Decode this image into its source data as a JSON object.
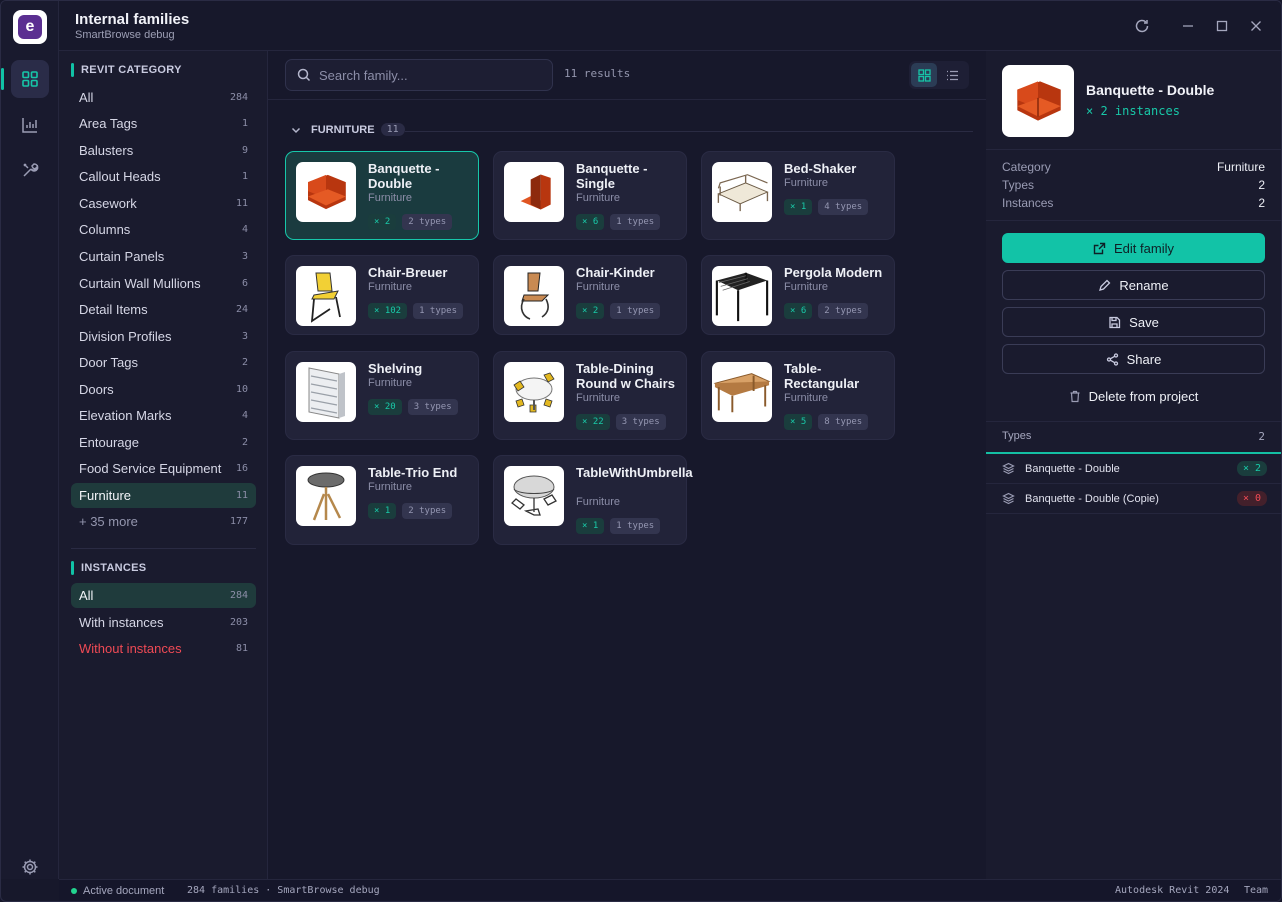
{
  "window": {
    "title": "Internal families",
    "subtitle": "SmartBrowse debug"
  },
  "rail": {
    "items": [
      "grid-icon",
      "chart-icon",
      "tools-icon"
    ],
    "settings": "gear-icon"
  },
  "sidebar": {
    "category_header": "REVIT CATEGORY",
    "categories": [
      {
        "label": "All",
        "count": "284"
      },
      {
        "label": "Area Tags",
        "count": "1"
      },
      {
        "label": "Balusters",
        "count": "9"
      },
      {
        "label": "Callout Heads",
        "count": "1"
      },
      {
        "label": "Casework",
        "count": "11"
      },
      {
        "label": "Columns",
        "count": "4"
      },
      {
        "label": "Curtain Panels",
        "count": "3"
      },
      {
        "label": "Curtain Wall Mullions",
        "count": "6"
      },
      {
        "label": "Detail Items",
        "count": "24"
      },
      {
        "label": "Division Profiles",
        "count": "3"
      },
      {
        "label": "Door Tags",
        "count": "2"
      },
      {
        "label": "Doors",
        "count": "10"
      },
      {
        "label": "Elevation Marks",
        "count": "4"
      },
      {
        "label": "Entourage",
        "count": "2"
      },
      {
        "label": "Food Service Equipment",
        "count": "16"
      },
      {
        "label": "Furniture",
        "count": "11"
      },
      {
        "label": "+ 35 more",
        "count": "177"
      }
    ],
    "instances_header": "INSTANCES",
    "instances": [
      {
        "label": "All",
        "count": "284"
      },
      {
        "label": "With instances",
        "count": "203"
      },
      {
        "label": "Without instances",
        "count": "81"
      }
    ]
  },
  "main": {
    "search_placeholder": "Search family...",
    "results": "11 results",
    "group": {
      "label": "FURNITURE",
      "count": "11"
    },
    "cards": [
      {
        "name": "Banquette - Double",
        "category": "Furniture",
        "instances": "× 2",
        "types": "2 types"
      },
      {
        "name": "Banquette - Single",
        "category": "Furniture",
        "instances": "× 6",
        "types": "1 types"
      },
      {
        "name": "Bed-Shaker",
        "category": "Furniture",
        "instances": "× 1",
        "types": "4 types"
      },
      {
        "name": "Chair-Breuer",
        "category": "Furniture",
        "instances": "× 102",
        "types": "1 types"
      },
      {
        "name": "Chair-Kinder",
        "category": "Furniture",
        "instances": "× 2",
        "types": "1 types"
      },
      {
        "name": "Pergola Modern",
        "category": "Furniture",
        "instances": "× 6",
        "types": "2 types"
      },
      {
        "name": "Shelving",
        "category": "Furniture",
        "instances": "× 20",
        "types": "3 types"
      },
      {
        "name": "Table-Dining Round w Chairs",
        "category": "Furniture",
        "instances": "× 22",
        "types": "3 types"
      },
      {
        "name": "Table-Rectangular",
        "category": "Furniture",
        "instances": "× 5",
        "types": "8 types"
      },
      {
        "name": "Table-Trio End",
        "category": "Furniture",
        "instances": "× 1",
        "types": "2 types"
      },
      {
        "name": "TableWithUmbrella",
        "category": "Furniture",
        "instances": "× 1",
        "types": "1 types"
      }
    ]
  },
  "detail": {
    "name": "Banquette - Double",
    "instances": "× 2 instances",
    "props": [
      {
        "label": "Category",
        "value": "Furniture"
      },
      {
        "label": "Types",
        "value": "2"
      },
      {
        "label": "Instances",
        "value": "2"
      }
    ],
    "actions": {
      "edit": "Edit family",
      "rename": "Rename",
      "save": "Save",
      "share": "Share",
      "delete": "Delete from project"
    },
    "types_header": "Types",
    "types_count": "2",
    "types": [
      {
        "name": "Banquette - Double",
        "count": "× 2"
      },
      {
        "name": "Banquette - Double (Copie)",
        "count": "× 0"
      }
    ]
  },
  "status": {
    "active": "Active document",
    "info": "284 families · SmartBrowse debug",
    "app": "Autodesk Revit 2024",
    "team": "Team"
  },
  "colors": {
    "accent": "#12c3a7",
    "danger": "#ef4a55",
    "bg": "#17182b"
  }
}
